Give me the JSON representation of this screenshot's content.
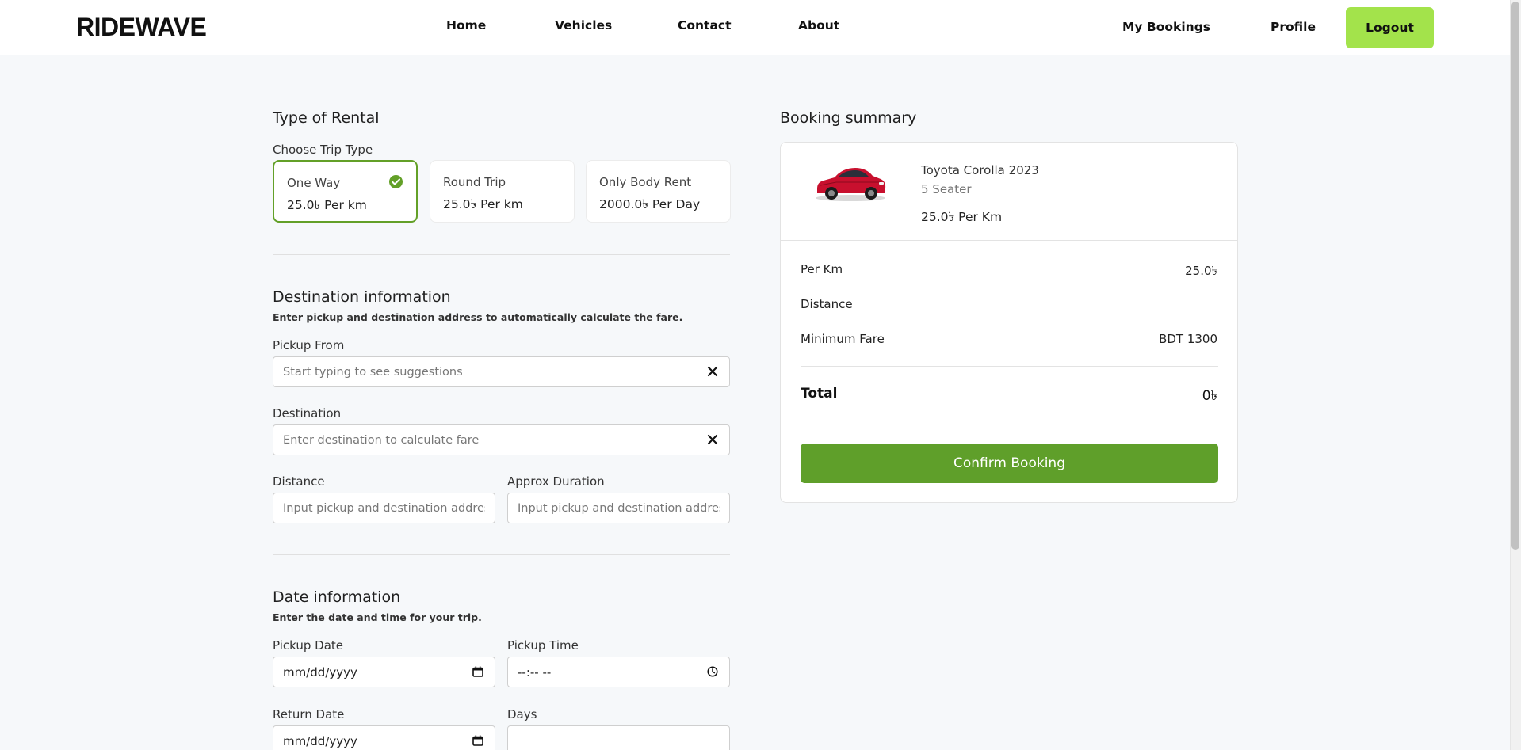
{
  "header": {
    "logo": "RIDEWAVE",
    "nav": [
      "Home",
      "Vehicles",
      "Contact",
      "About"
    ],
    "my_bookings": "My Bookings",
    "profile": "Profile",
    "logout": "Logout"
  },
  "rental": {
    "title": "Type of Rental",
    "choose_label": "Choose Trip Type",
    "options": [
      {
        "name": "One Way",
        "price": "25.0৳ Per km",
        "selected": true
      },
      {
        "name": "Round Trip",
        "price": "25.0৳ Per km",
        "selected": false
      },
      {
        "name": "Only Body Rent",
        "price": "2000.0৳ Per Day",
        "selected": false
      }
    ]
  },
  "destination": {
    "title": "Destination information",
    "subtitle": "Enter pickup and destination address to automatically calculate the fare.",
    "pickup_label": "Pickup From",
    "pickup_placeholder": "Start typing to see suggestions",
    "destination_label": "Destination",
    "destination_placeholder": "Enter destination to calculate fare",
    "distance_label": "Distance",
    "distance_placeholder": "Input pickup and destination address",
    "duration_label": "Approx Duration",
    "duration_placeholder": "Input pickup and destination address"
  },
  "date": {
    "title": "Date information",
    "subtitle": "Enter the date and time for your trip.",
    "pickup_date_label": "Pickup Date",
    "pickup_date_value": "mm/dd/yyyy",
    "pickup_time_label": "Pickup Time",
    "pickup_time_value": "--:-- --",
    "return_date_label": "Return Date",
    "return_date_value": "mm/dd/yyyy",
    "days_label": "Days",
    "days_value": ""
  },
  "summary": {
    "title": "Booking summary",
    "car_name": "Toyota Corolla 2023",
    "car_seats": "5 Seater",
    "car_rate": "25.0৳ Per Km",
    "per_km_label": "Per Km",
    "per_km_value": "25.0৳",
    "distance_label": "Distance",
    "distance_value": "",
    "min_fare_label": "Minimum Fare",
    "min_fare_value": "BDT 1300",
    "total_label": "Total",
    "total_value": "0৳",
    "confirm": "Confirm Booking"
  },
  "colors": {
    "accent_green": "#63a028",
    "button_green": "#5f9f2a",
    "logout_lime": "#a3e34b",
    "car_red": "#c8102e"
  },
  "icons": {
    "check": "check-circle-icon",
    "clear": "close-icon",
    "calendar": "calendar-icon",
    "clock": "clock-icon"
  }
}
